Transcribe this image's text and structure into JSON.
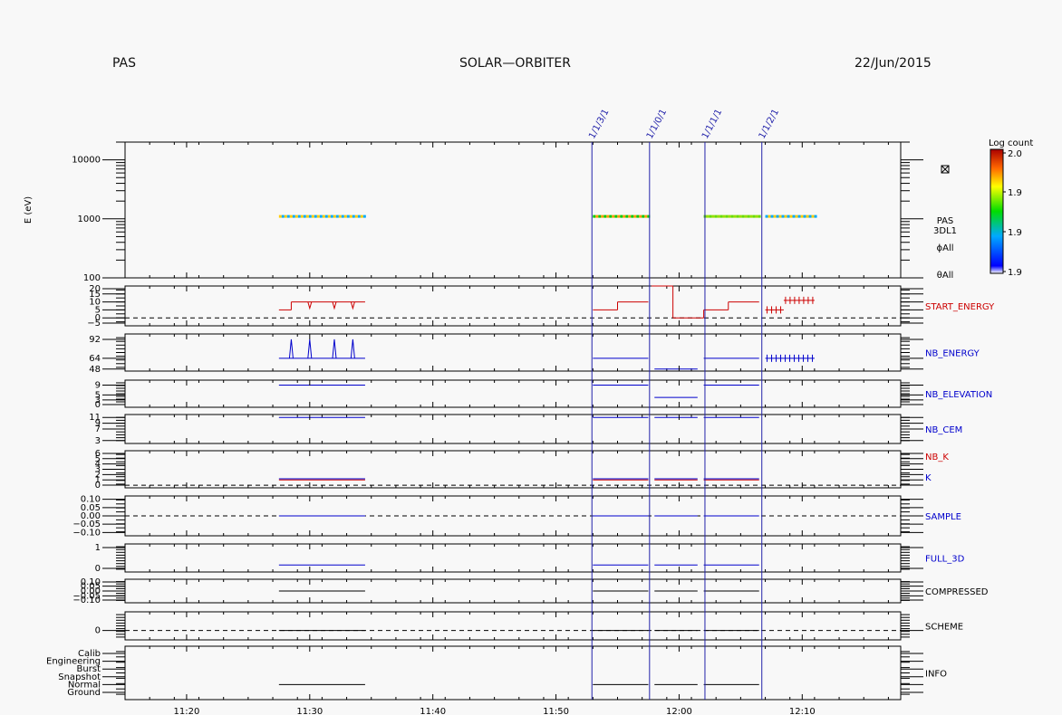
{
  "header": {
    "left": "PAS",
    "center": "SOLAR—ORBITER",
    "right": "22/Jun/2015"
  },
  "colors": {
    "frame": "#000000",
    "marker": "#2222aa",
    "red": "#cc0000",
    "blue": "#0000cc",
    "black": "#000000"
  },
  "colorbar": {
    "title": "Log count",
    "ticks": [
      "2.0",
      "1.9",
      "1.9",
      "1.9"
    ]
  },
  "spectrogram_labels": [
    "PAS",
    "3DL1",
    "ϕAll",
    "θAll"
  ],
  "markers": [
    {
      "time": 11.882,
      "label": "1/1/3/1"
    },
    {
      "time": 11.96,
      "label": "1/1/0/1"
    },
    {
      "time": 12.035,
      "label": "1/1/1/1"
    },
    {
      "time": 12.112,
      "label": "1/1/2/1"
    }
  ],
  "chart_data": {
    "type": "line",
    "x_range": [
      "11:15",
      "12:18"
    ],
    "x_ticks": [
      "11:20",
      "11:30",
      "11:40",
      "11:50",
      "12:00",
      "12:10"
    ],
    "panels": [
      {
        "name": "spectrogram",
        "ylabel": "E (eV)",
        "scale": "log",
        "ylim": [
          100,
          20000
        ],
        "yticks": [
          "10000",
          "1000",
          "100"
        ],
        "segments": [
          {
            "t0": "11:27:30",
            "t1": "11:34:30",
            "energy": 1100,
            "log_count": 1.9
          },
          {
            "t0": "11:53:00",
            "t1": "11:57:30",
            "energy": 1100,
            "log_count": 1.9
          },
          {
            "t0": "12:02:00",
            "t1": "12:06:30",
            "energy": 1100,
            "log_count": 1.9
          },
          {
            "t0": "12:07:00",
            "t1": "12:11:00",
            "energy": 1100,
            "log_count": 1.9
          }
        ]
      },
      {
        "name": "START_ENERGY",
        "label_color": "#cc0000",
        "ylim": [
          -5,
          20
        ],
        "yticks": [
          "20",
          "15",
          "10",
          "5",
          "0",
          "−5"
        ],
        "zero_line": true,
        "series": [
          {
            "color": "#cc0000",
            "runs": [
              {
                "t0": "11:27:30",
                "t1": "11:28:30",
                "value": 5
              },
              {
                "t0": "11:28:30",
                "t1": "11:34:30",
                "value": 10,
                "dips": [
                  "11:30:00",
                  "11:32:00",
                  "11:33:30"
                ]
              },
              {
                "t0": "11:53:00",
                "t1": "11:55:00",
                "value": 5
              },
              {
                "t0": "11:55:00",
                "t1": "11:57:30",
                "value": 10
              },
              {
                "t0": "11:57:45",
                "t1": "11:59:30",
                "value": 20
              },
              {
                "t0": "11:59:30",
                "t1": "12:02:00",
                "value": 0
              },
              {
                "t0": "12:02:00",
                "t1": "12:04:00",
                "value": 5
              },
              {
                "t0": "12:04:00",
                "t1": "12:06:30",
                "value": 10
              }
            ],
            "ticks": [
              {
                "t0": "12:07:00",
                "t1": "12:08:30",
                "value": 5
              },
              {
                "t0": "12:08:30",
                "t1": "12:11:00",
                "value": 11
              }
            ]
          }
        ]
      },
      {
        "name": "NB_ENERGY",
        "label_color": "#0000cc",
        "ylim": [
          45,
          100
        ],
        "yticks": [
          "92",
          "64",
          "48"
        ],
        "series": [
          {
            "color": "#0000cc",
            "runs": [
              {
                "t0": "11:27:30",
                "t1": "11:34:30",
                "value": 64,
                "spikes": [
                  "11:28:30",
                  "11:30:00",
                  "11:32:00",
                  "11:33:30"
                ],
                "spike_value": 92
              },
              {
                "t0": "11:53:00",
                "t1": "11:57:30",
                "value": 64
              },
              {
                "t0": "11:58:00",
                "t1": "12:01:30",
                "value": 48
              },
              {
                "t0": "12:02:00",
                "t1": "12:06:30",
                "value": 64
              }
            ],
            "ticks": [
              {
                "t0": "12:07:00",
                "t1": "12:11:00",
                "value": 64
              }
            ]
          }
        ]
      },
      {
        "name": "NB_ELEVATION",
        "label_color": "#0000cc",
        "ylim": [
          0,
          11
        ],
        "yticks": [
          "9",
          "5",
          "3",
          "0"
        ],
        "series": [
          {
            "color": "#0000cc",
            "runs": [
              {
                "t0": "11:27:30",
                "t1": "11:34:30",
                "value": 9
              },
              {
                "t0": "11:53:00",
                "t1": "11:57:30",
                "value": 9
              },
              {
                "t0": "11:58:00",
                "t1": "12:01:30",
                "value": 4
              },
              {
                "t0": "12:02:00",
                "t1": "12:06:30",
                "value": 9
              }
            ]
          }
        ]
      },
      {
        "name": "NB_CEM",
        "label_color": "#0000cc",
        "ylim": [
          2,
          12
        ],
        "yticks": [
          "11",
          "9",
          "7",
          "3"
        ],
        "series": [
          {
            "color": "#0000cc",
            "runs": [
              {
                "t0": "11:27:30",
                "t1": "11:34:30",
                "value": 11
              },
              {
                "t0": "11:53:00",
                "t1": "11:57:30",
                "value": 11
              },
              {
                "t0": "11:58:00",
                "t1": "12:01:30",
                "value": 11
              },
              {
                "t0": "12:02:00",
                "t1": "12:06:30",
                "value": 11
              }
            ]
          }
        ]
      },
      {
        "name": "NB_K",
        "extra_label": "K",
        "label_color": "#cc0000",
        "extra_label_color": "#0000cc",
        "ylim": [
          -0.5,
          6.5
        ],
        "yticks": [
          "6",
          "5",
          "4",
          "3",
          "2",
          "1",
          "0"
        ],
        "zero_line": true,
        "series": [
          {
            "color": "#cc0000",
            "runs": [
              {
                "t0": "11:27:30",
                "t1": "11:34:30",
                "value": 1
              },
              {
                "t0": "11:53:00",
                "t1": "11:57:30",
                "value": 1
              },
              {
                "t0": "11:58:00",
                "t1": "12:01:30",
                "value": 1
              },
              {
                "t0": "12:02:00",
                "t1": "12:06:30",
                "value": 1
              }
            ]
          },
          {
            "color": "#0000cc",
            "runs": [
              {
                "t0": "11:27:30",
                "t1": "11:34:30",
                "value": 1.2
              },
              {
                "t0": "11:53:00",
                "t1": "11:57:30",
                "value": 1.2
              },
              {
                "t0": "11:58:00",
                "t1": "12:01:30",
                "value": 1.2
              },
              {
                "t0": "12:02:00",
                "t1": "12:06:30",
                "value": 1.2
              }
            ]
          }
        ]
      },
      {
        "name": "SAMPLE",
        "label_color": "#0000cc",
        "ylim": [
          -0.12,
          0.12
        ],
        "yticks": [
          "0.10",
          "0.05",
          "0.00",
          "−0.05",
          "−0.10"
        ],
        "zero_line": true,
        "series": [
          {
            "color": "#0000cc",
            "runs": [
              {
                "t0": "11:27:30",
                "t1": "11:34:30",
                "value": 0
              },
              {
                "t0": "11:53:00",
                "t1": "11:57:30",
                "value": 0
              },
              {
                "t0": "11:58:00",
                "t1": "12:01:30",
                "value": 0
              },
              {
                "t0": "12:02:00",
                "t1": "12:06:30",
                "value": 0
              }
            ]
          }
        ]
      },
      {
        "name": "FULL_3D",
        "label_color": "#0000cc",
        "ylim": [
          -0.5,
          1.5
        ],
        "yticks": [
          "1",
          "0"
        ],
        "series": [
          {
            "color": "#0000cc",
            "runs": [
              {
                "t0": "11:27:30",
                "t1": "11:34:30",
                "value": 0
              },
              {
                "t0": "11:53:00",
                "t1": "11:57:30",
                "value": 0
              },
              {
                "t0": "11:58:00",
                "t1": "12:01:30",
                "value": 0
              },
              {
                "t0": "12:02:00",
                "t1": "12:06:30",
                "value": 0
              }
            ]
          }
        ]
      },
      {
        "name": "COMPRESSED",
        "label_color": "#000000",
        "ylim": [
          -0.12,
          0.12
        ],
        "yticks": [
          "0.10",
          "0.05",
          "0.00",
          "−0.05",
          "−0.10"
        ],
        "series": [
          {
            "color": "#000000",
            "runs": [
              {
                "t0": "11:27:30",
                "t1": "11:34:30",
                "value": 0
              },
              {
                "t0": "11:53:00",
                "t1": "11:57:30",
                "value": 0
              },
              {
                "t0": "11:58:00",
                "t1": "12:01:30",
                "value": 0
              },
              {
                "t0": "12:02:00",
                "t1": "12:06:30",
                "value": 0
              }
            ]
          }
        ]
      },
      {
        "name": "SCHEME",
        "label_color": "#000000",
        "ylim": [
          -1,
          2
        ],
        "yticks": [
          "0"
        ],
        "zero_line": true,
        "series": [
          {
            "color": "#000000",
            "runs": [
              {
                "t0": "11:27:30",
                "t1": "11:34:30",
                "value": 0
              },
              {
                "t0": "11:53:00",
                "t1": "11:57:30",
                "value": 0
              },
              {
                "t0": "11:58:00",
                "t1": "12:01:30",
                "value": 0
              },
              {
                "t0": "12:02:00",
                "t1": "12:06:30",
                "value": 0
              }
            ]
          }
        ]
      },
      {
        "name": "INFO",
        "label_color": "#000000",
        "categorical": true,
        "ylim": [
          0,
          7
        ],
        "yticks": [
          "Calib",
          "Engineering",
          "Burst",
          "Snapshot",
          "Normal",
          "Ground"
        ],
        "series": [
          {
            "color": "#000000",
            "runs": [
              {
                "t0": "11:27:30",
                "t1": "11:34:30",
                "value": "Normal"
              },
              {
                "t0": "11:53:00",
                "t1": "11:57:30",
                "value": "Normal"
              },
              {
                "t0": "11:58:00",
                "t1": "12:01:30",
                "value": "Normal"
              },
              {
                "t0": "12:02:00",
                "t1": "12:06:30",
                "value": "Normal"
              }
            ]
          }
        ]
      }
    ]
  }
}
